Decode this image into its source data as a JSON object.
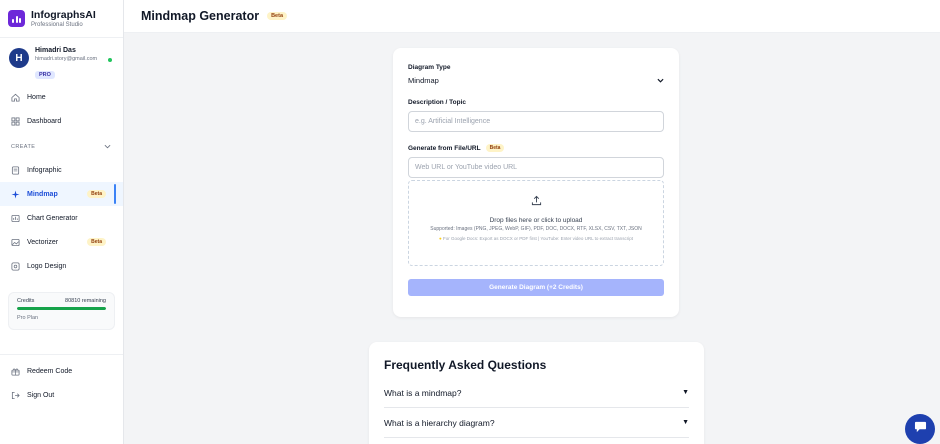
{
  "brand": {
    "name": "InfographsAI",
    "subtitle": "Professional Studio"
  },
  "user": {
    "initial": "H",
    "name": "Himadri Das",
    "email": "himadri.story@gmail.com",
    "plan_badge": "PRO"
  },
  "nav": {
    "home": "Home",
    "dashboard": "Dashboard",
    "section_create": "CREATE",
    "infographic": "Infographic",
    "mindmap": "Mindmap",
    "mindmap_badge": "Beta",
    "chart_generator": "Chart Generator",
    "vectorizer": "Vectorizer",
    "vectorizer_badge": "Beta",
    "logo_design": "Logo Design",
    "redeem": "Redeem Code",
    "sign_out": "Sign Out"
  },
  "credits": {
    "label": "Credits",
    "remaining": "80810 remaining",
    "plan": "Pro Plan",
    "fill_fraction": 1.0,
    "bar_color": "#16a34a"
  },
  "header": {
    "title": "Mindmap Generator",
    "badge": "Beta"
  },
  "form": {
    "diagram_type_label": "Diagram Type",
    "diagram_type_value": "Mindmap",
    "description_label": "Description / Topic",
    "description_placeholder": "e.g. Artificial Intelligence",
    "file_label": "Generate from File/URL",
    "file_badge": "Beta",
    "url_placeholder": "Web URL or YouTube video URL",
    "drop_title": "Drop files here or click to upload",
    "drop_formats": "Supported: Images (PNG, JPEG, WebP, GIF), PDF, DOC, DOCX, RTF, XLSX, CSV, TXT, JSON",
    "drop_hint": "For Google Docs: Export as DOCX or PDF first | YouTube: Enter video URL to extract transcript",
    "generate_button": "Generate Diagram (+2 Credits)"
  },
  "faq": {
    "title": "Frequently Asked Questions",
    "items": [
      {
        "question": "What is a mindmap?"
      },
      {
        "question": "What is a hierarchy diagram?"
      }
    ]
  },
  "colors": {
    "accent": "#1d4ed8",
    "brand": "#6d28d9",
    "button_disabled": "#a5b4fc",
    "beta_bg": "#fef3c7"
  }
}
